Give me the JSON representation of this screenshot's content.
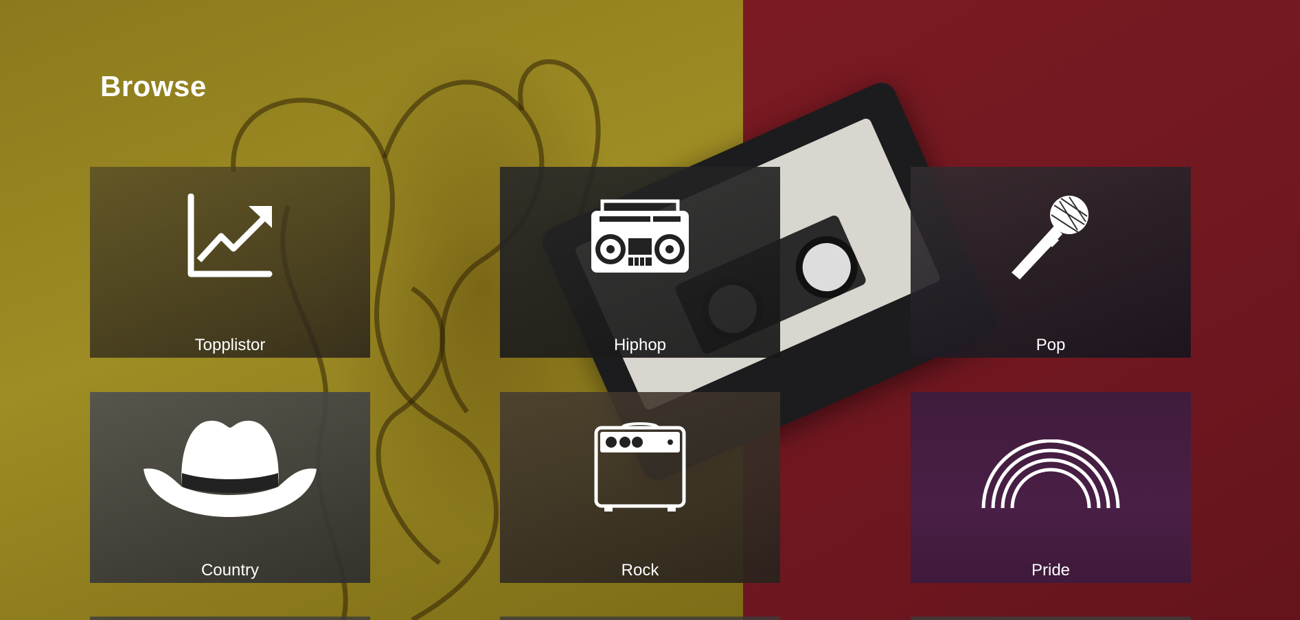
{
  "page": {
    "title": "Browse"
  },
  "categories": [
    {
      "label": "Topplistor",
      "icon": "trending-chart-icon"
    },
    {
      "label": "Hiphop",
      "icon": "boombox-icon"
    },
    {
      "label": "Pop",
      "icon": "microphone-icon"
    },
    {
      "label": "Country",
      "icon": "cowboy-hat-icon"
    },
    {
      "label": "Rock",
      "icon": "amplifier-icon"
    },
    {
      "label": "Pride",
      "icon": "rainbow-icon"
    }
  ],
  "colors": {
    "background_left": "#9e8c24",
    "background_right": "#7c1a22",
    "pride_tile": "#4a1f46",
    "text": "#ffffff"
  }
}
